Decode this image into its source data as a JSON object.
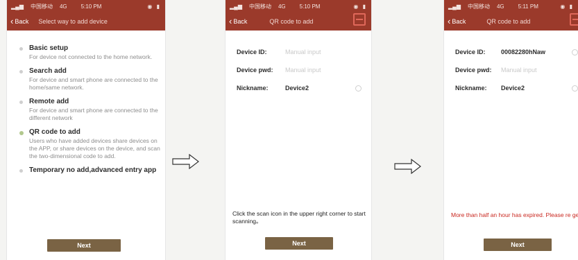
{
  "screens": [
    {
      "status": {
        "carrier": "中国移动",
        "network": "4G",
        "time": "5:10 PM"
      },
      "nav": {
        "back_label": "Back",
        "title": "Select way to add device"
      },
      "options": [
        {
          "title": "Basic setup",
          "desc": "For device not connected to the home network."
        },
        {
          "title": "Search add",
          "desc": "For device and smart phone are connected to the home/same network."
        },
        {
          "title": "Remote add",
          "desc": "For device and smart phone are connected to the different network"
        },
        {
          "title": "QR code to add",
          "desc": "Users who have added devices share devices on the APP, or share devices on the device, and scan the two-dimensional code to add."
        },
        {
          "title": "Temporary no add,advanced entry app",
          "desc": ""
        }
      ],
      "next_label": "Next"
    },
    {
      "status": {
        "carrier": "中国移动",
        "network": "4G",
        "time": "5:10 PM"
      },
      "nav": {
        "back_label": "Back",
        "title": "QR code to add"
      },
      "fields": {
        "device_id": {
          "label": "Device ID:",
          "placeholder": "Manual input"
        },
        "device_pwd": {
          "label": "Device pwd:",
          "placeholder": "Manual input"
        },
        "nickname": {
          "label": "Nickname:",
          "value": "Device2"
        }
      },
      "hint": "Click the scan icon in the upper right corner to start scanning。",
      "next_label": "Next"
    },
    {
      "status": {
        "carrier": "中国移动",
        "network": "4G",
        "time": "5:11 PM"
      },
      "nav": {
        "back_label": "Back",
        "title": "QR code to add"
      },
      "fields": {
        "device_id": {
          "label": "Device ID:",
          "value": "00082280hNaw"
        },
        "device_pwd": {
          "label": "Device pwd:",
          "placeholder": "Manual input"
        },
        "nickname": {
          "label": "Nickname:",
          "value": "Device2"
        }
      },
      "error": "More than half an hour has expired. Please re generate the QR code。",
      "next_label": "Next"
    }
  ],
  "colors": {
    "header": "#9b3a2b",
    "button": "#7a6344",
    "error": "#c9271f",
    "active_dot": "#b2c88e"
  }
}
